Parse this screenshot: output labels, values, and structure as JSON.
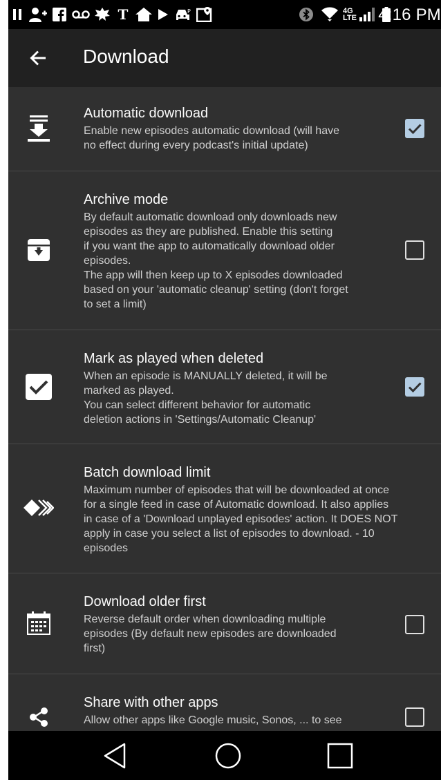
{
  "status_bar": {
    "time": "4:16 PM",
    "icons": [
      "pause-icon",
      "add-person-icon",
      "facebook-icon",
      "voicemail-icon",
      "leaf-icon",
      "nytimes-icon",
      "home-icon",
      "play-store-icon",
      "car-icon",
      "location-icon",
      "bluetooth-icon",
      "wifi-icon",
      "lte-icon",
      "signal-icon",
      "battery-icon"
    ]
  },
  "toolbar": {
    "title": "Download",
    "back_icon": "arrow-left-icon"
  },
  "settings": [
    {
      "key": "automatic_download",
      "icon": "download-icon",
      "title": "Automatic download",
      "summary": [
        "Enable new episodes automatic download (will have",
        "no effect during every podcast's initial update)"
      ],
      "checked": true
    },
    {
      "key": "archive_mode",
      "icon": "archive-icon",
      "title": "Archive mode",
      "summary": [
        "By default automatic download only downloads new",
        "episodes as they are published. Enable this setting",
        "if you want the app to automatically download older",
        "episodes.",
        "The app will then keep up to X episodes downloaded",
        "based on your 'automatic cleanup' setting (don't forget",
        "to set a limit)"
      ],
      "checked": false
    },
    {
      "key": "mark_played_deleted",
      "icon": "check-box-icon",
      "title": "Mark as played when deleted",
      "summary": [
        "When an episode is MANUALLY deleted, it will be",
        "marked as played.",
        "You can select different behavior for automatic",
        "deletion actions in 'Settings/Automatic Cleanup'"
      ],
      "checked": true
    },
    {
      "key": "batch_download_limit",
      "icon": "batch-chevrons-icon",
      "title": "Batch download limit",
      "summary": [
        "Maximum number of episodes that will be downloaded at once",
        "for a single feed in case of Automatic download. It also applies",
        "in case of a 'Download unplayed episodes' action. It DOES NOT",
        "apply in case you select a list of episodes to download. - 10",
        "episodes"
      ]
    },
    {
      "key": "download_older_first",
      "icon": "calendar-icon",
      "title": "Download older first",
      "summary": [
        "Reverse default order when downloading multiple",
        "episodes (By default new episodes are downloaded",
        "first)"
      ],
      "checked": false
    },
    {
      "key": "share_other_apps",
      "icon": "share-icon",
      "title": "Share with other apps",
      "summary": [
        "Allow other apps like Google music, Sonos, ... to see"
      ],
      "checked": false
    }
  ],
  "nav_bar": {
    "icons": [
      "back-triangle-icon",
      "home-circle-icon",
      "recents-square-icon"
    ]
  }
}
